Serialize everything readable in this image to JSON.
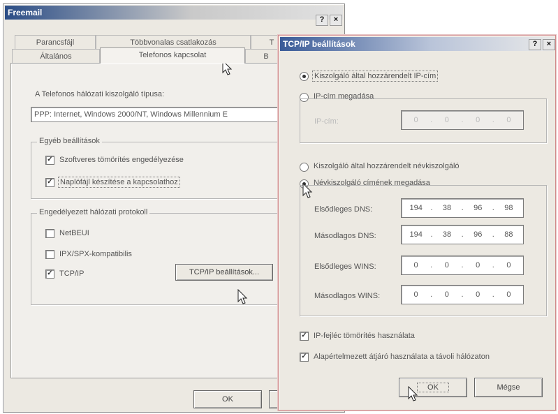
{
  "dialog_main": {
    "title": "Freemail",
    "help_button": "?",
    "close_button": "×",
    "tabs_row1": [
      "Parancsfájl",
      "Többvonalas csatlakozás",
      "T"
    ],
    "tabs_row2": [
      "Általános",
      "Telefonos kapcsolat",
      "B"
    ],
    "server_type_label": "A Telefonos hálózati kiszolgáló típusa:",
    "server_type_value": "PPP: Internet, Windows 2000/NT, Windows Millennium E",
    "other_settings": {
      "legend": "Egyéb beállítások",
      "items": [
        {
          "label": "Szoftveres tömörítés engedélyezése",
          "checked": true
        },
        {
          "label": "Naplófájl készítése a kapcsolathoz",
          "checked": true
        }
      ]
    },
    "protocols": {
      "legend": "Engedélyezett hálózati protokoll",
      "items": [
        {
          "label": "NetBEUI",
          "checked": false
        },
        {
          "label": "IPX/SPX-kompatibilis",
          "checked": false
        },
        {
          "label": "TCP/IP",
          "checked": true
        }
      ],
      "tcpip_settings_button": "TCP/IP beállítások..."
    },
    "ok_button": "OK"
  },
  "dialog_tcpip": {
    "title": "TCP/IP beállítások",
    "help_button": "?",
    "close_button": "×",
    "ip_assigned_radio": "Kiszolgáló által hozzárendelt IP-cím",
    "ip_specify_radio": "IP-cím megadása",
    "ip_label": "IP-cím:",
    "ip_value": [
      "0",
      "0",
      "0",
      "0"
    ],
    "dns_assigned_radio": "Kiszolgáló által hozzárendelt névkiszolgáló",
    "dns_specify_radio": "Névkiszolgáló címének megadása",
    "primary_dns_label": "Elsődleges DNS:",
    "primary_dns_value": [
      "194",
      "38",
      "96",
      "98"
    ],
    "secondary_dns_label": "Másodlagos DNS:",
    "secondary_dns_value": [
      "194",
      "38",
      "96",
      "88"
    ],
    "primary_wins_label": "Elsődleges WINS:",
    "primary_wins_value": [
      "0",
      "0",
      "0",
      "0"
    ],
    "secondary_wins_label": "Másodlagos WINS:",
    "secondary_wins_value": [
      "0",
      "0",
      "0",
      "0"
    ],
    "header_compression": {
      "label": "IP-fejléc tömörítés használata",
      "checked": true
    },
    "default_gateway": {
      "label": "Alapértelmezett átjáró használata a távoli hálózaton",
      "checked": true
    },
    "ok_button": "OK",
    "cancel_button": "Mégse"
  },
  "colors": {
    "dialog_bg": "#ece9e2",
    "title_active": "#2b4d86",
    "front_border": "#d08a8a"
  }
}
